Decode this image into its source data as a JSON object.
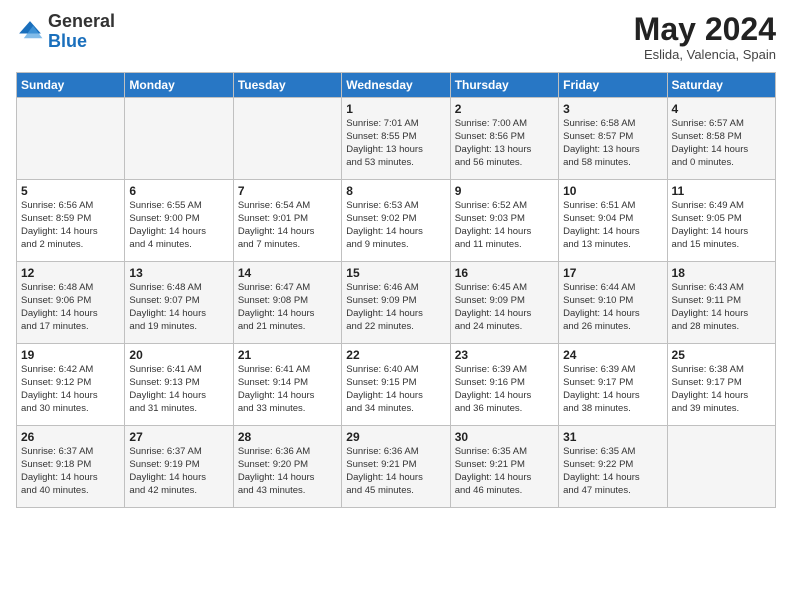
{
  "header": {
    "logo_general": "General",
    "logo_blue": "Blue",
    "month_year": "May 2024",
    "location": "Eslida, Valencia, Spain"
  },
  "weekdays": [
    "Sunday",
    "Monday",
    "Tuesday",
    "Wednesday",
    "Thursday",
    "Friday",
    "Saturday"
  ],
  "weeks": [
    [
      {
        "day": "",
        "info": ""
      },
      {
        "day": "",
        "info": ""
      },
      {
        "day": "",
        "info": ""
      },
      {
        "day": "1",
        "info": "Sunrise: 7:01 AM\nSunset: 8:55 PM\nDaylight: 13 hours\nand 53 minutes."
      },
      {
        "day": "2",
        "info": "Sunrise: 7:00 AM\nSunset: 8:56 PM\nDaylight: 13 hours\nand 56 minutes."
      },
      {
        "day": "3",
        "info": "Sunrise: 6:58 AM\nSunset: 8:57 PM\nDaylight: 13 hours\nand 58 minutes."
      },
      {
        "day": "4",
        "info": "Sunrise: 6:57 AM\nSunset: 8:58 PM\nDaylight: 14 hours\nand 0 minutes."
      }
    ],
    [
      {
        "day": "5",
        "info": "Sunrise: 6:56 AM\nSunset: 8:59 PM\nDaylight: 14 hours\nand 2 minutes."
      },
      {
        "day": "6",
        "info": "Sunrise: 6:55 AM\nSunset: 9:00 PM\nDaylight: 14 hours\nand 4 minutes."
      },
      {
        "day": "7",
        "info": "Sunrise: 6:54 AM\nSunset: 9:01 PM\nDaylight: 14 hours\nand 7 minutes."
      },
      {
        "day": "8",
        "info": "Sunrise: 6:53 AM\nSunset: 9:02 PM\nDaylight: 14 hours\nand 9 minutes."
      },
      {
        "day": "9",
        "info": "Sunrise: 6:52 AM\nSunset: 9:03 PM\nDaylight: 14 hours\nand 11 minutes."
      },
      {
        "day": "10",
        "info": "Sunrise: 6:51 AM\nSunset: 9:04 PM\nDaylight: 14 hours\nand 13 minutes."
      },
      {
        "day": "11",
        "info": "Sunrise: 6:49 AM\nSunset: 9:05 PM\nDaylight: 14 hours\nand 15 minutes."
      }
    ],
    [
      {
        "day": "12",
        "info": "Sunrise: 6:48 AM\nSunset: 9:06 PM\nDaylight: 14 hours\nand 17 minutes."
      },
      {
        "day": "13",
        "info": "Sunrise: 6:48 AM\nSunset: 9:07 PM\nDaylight: 14 hours\nand 19 minutes."
      },
      {
        "day": "14",
        "info": "Sunrise: 6:47 AM\nSunset: 9:08 PM\nDaylight: 14 hours\nand 21 minutes."
      },
      {
        "day": "15",
        "info": "Sunrise: 6:46 AM\nSunset: 9:09 PM\nDaylight: 14 hours\nand 22 minutes."
      },
      {
        "day": "16",
        "info": "Sunrise: 6:45 AM\nSunset: 9:09 PM\nDaylight: 14 hours\nand 24 minutes."
      },
      {
        "day": "17",
        "info": "Sunrise: 6:44 AM\nSunset: 9:10 PM\nDaylight: 14 hours\nand 26 minutes."
      },
      {
        "day": "18",
        "info": "Sunrise: 6:43 AM\nSunset: 9:11 PM\nDaylight: 14 hours\nand 28 minutes."
      }
    ],
    [
      {
        "day": "19",
        "info": "Sunrise: 6:42 AM\nSunset: 9:12 PM\nDaylight: 14 hours\nand 30 minutes."
      },
      {
        "day": "20",
        "info": "Sunrise: 6:41 AM\nSunset: 9:13 PM\nDaylight: 14 hours\nand 31 minutes."
      },
      {
        "day": "21",
        "info": "Sunrise: 6:41 AM\nSunset: 9:14 PM\nDaylight: 14 hours\nand 33 minutes."
      },
      {
        "day": "22",
        "info": "Sunrise: 6:40 AM\nSunset: 9:15 PM\nDaylight: 14 hours\nand 34 minutes."
      },
      {
        "day": "23",
        "info": "Sunrise: 6:39 AM\nSunset: 9:16 PM\nDaylight: 14 hours\nand 36 minutes."
      },
      {
        "day": "24",
        "info": "Sunrise: 6:39 AM\nSunset: 9:17 PM\nDaylight: 14 hours\nand 38 minutes."
      },
      {
        "day": "25",
        "info": "Sunrise: 6:38 AM\nSunset: 9:17 PM\nDaylight: 14 hours\nand 39 minutes."
      }
    ],
    [
      {
        "day": "26",
        "info": "Sunrise: 6:37 AM\nSunset: 9:18 PM\nDaylight: 14 hours\nand 40 minutes."
      },
      {
        "day": "27",
        "info": "Sunrise: 6:37 AM\nSunset: 9:19 PM\nDaylight: 14 hours\nand 42 minutes."
      },
      {
        "day": "28",
        "info": "Sunrise: 6:36 AM\nSunset: 9:20 PM\nDaylight: 14 hours\nand 43 minutes."
      },
      {
        "day": "29",
        "info": "Sunrise: 6:36 AM\nSunset: 9:21 PM\nDaylight: 14 hours\nand 45 minutes."
      },
      {
        "day": "30",
        "info": "Sunrise: 6:35 AM\nSunset: 9:21 PM\nDaylight: 14 hours\nand 46 minutes."
      },
      {
        "day": "31",
        "info": "Sunrise: 6:35 AM\nSunset: 9:22 PM\nDaylight: 14 hours\nand 47 minutes."
      },
      {
        "day": "",
        "info": ""
      }
    ]
  ]
}
